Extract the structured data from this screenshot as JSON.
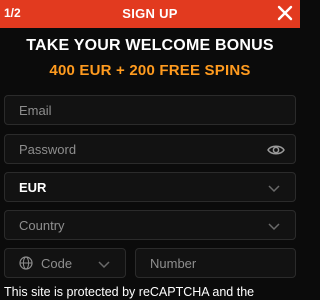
{
  "header": {
    "step": "1/2",
    "title": "SIGN UP"
  },
  "bonus": {
    "title": "TAKE YOUR WELCOME BONUS",
    "offer": "400 EUR + 200 FREE SPINS"
  },
  "form": {
    "email_placeholder": "Email",
    "password_placeholder": "Password",
    "currency_value": "EUR",
    "country_placeholder": "Country",
    "code_placeholder": "Code",
    "number_placeholder": "Number"
  },
  "footer": {
    "recaptcha_text": "This site is protected by reCAPTCHA and the"
  },
  "colors": {
    "header_bg": "#e23a1f",
    "accent": "#ff9b1f",
    "background": "#0b0b0b"
  },
  "icons": [
    "close-icon",
    "eye-icon",
    "chevron-down-icon",
    "globe-icon"
  ]
}
